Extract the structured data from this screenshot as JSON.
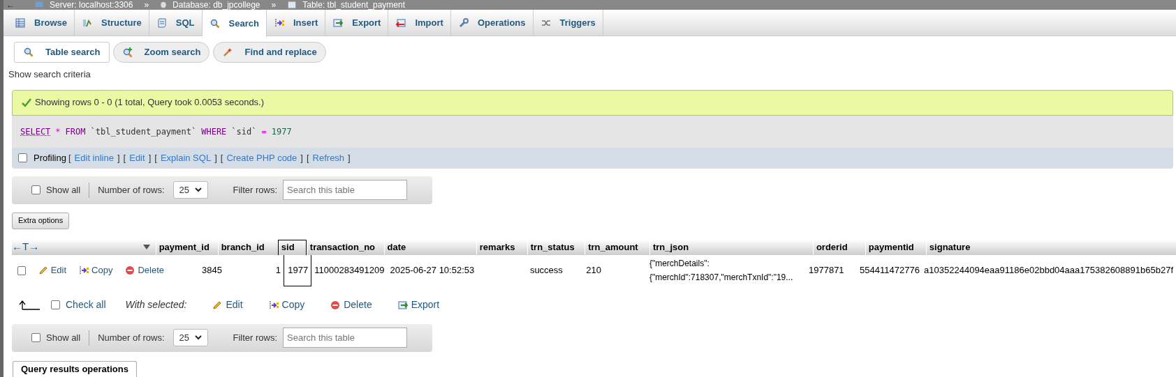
{
  "breadcrumb": [
    {
      "kind": "server",
      "label": "Server: localhost:3306"
    },
    {
      "kind": "database",
      "label": "Database: db_jpcollege"
    },
    {
      "kind": "table",
      "label": "Table: tbl_student_payment"
    }
  ],
  "breadcrumb_separator": "»",
  "back_arrow": "←",
  "tabs": [
    {
      "kind": "browse",
      "label": "Browse",
      "selected": false
    },
    {
      "kind": "structure",
      "label": "Structure",
      "selected": false
    },
    {
      "kind": "sql",
      "label": "SQL",
      "selected": false
    },
    {
      "kind": "search",
      "label": "Search",
      "selected": true
    },
    {
      "kind": "insert",
      "label": "Insert",
      "selected": false
    },
    {
      "kind": "export",
      "label": "Export",
      "selected": false
    },
    {
      "kind": "import",
      "label": "Import",
      "selected": false
    },
    {
      "kind": "operations",
      "label": "Operations",
      "selected": false
    },
    {
      "kind": "triggers",
      "label": "Triggers",
      "selected": false
    }
  ],
  "subtabs": [
    {
      "kind": "search",
      "label": "Table search",
      "selected": true
    },
    {
      "kind": "zoom",
      "label": "Zoom search",
      "selected": false
    },
    {
      "kind": "replace",
      "label": "Find and replace",
      "selected": false
    }
  ],
  "show_search_criteria": "Show search criteria",
  "message": "Showing rows 0 - 0 (1 total, Query took 0.0053 seconds.)",
  "sql": [
    {
      "kind": "keyword",
      "text": "SELECT"
    },
    {
      "kind": "op",
      "text": "*"
    },
    {
      "kind": "keyword",
      "text": "FROM"
    },
    {
      "kind": "ident",
      "text": "`tbl_student_payment`"
    },
    {
      "kind": "keyword",
      "text": "WHERE"
    },
    {
      "kind": "ident",
      "text": "`sid`"
    },
    {
      "kind": "op",
      "text": "="
    },
    {
      "kind": "number",
      "text": "1977"
    }
  ],
  "profiling": {
    "label": "Profiling",
    "checked": false,
    "open_bracket": "[",
    "close_bracket": "]",
    "links": [
      "Edit inline",
      "Edit",
      "Explain SQL",
      "Create PHP code",
      "Refresh"
    ]
  },
  "nav_bars": [
    {
      "show_all": "Show all",
      "show_all_checked": false,
      "rows_label": "Number of rows:",
      "rows_value": "25",
      "filter_label": "Filter rows:",
      "filter_placeholder": "Search this table"
    },
    {
      "show_all": "Show all",
      "show_all_checked": false,
      "rows_label": "Number of rows:",
      "rows_value": "25",
      "filter_label": "Filter rows:",
      "filter_placeholder": "Search this table"
    }
  ],
  "extra_options": "Extra options",
  "table": {
    "arrows": "←T→",
    "columns": [
      {
        "label": "payment_id",
        "kind": "int",
        "marked": false
      },
      {
        "label": "branch_id",
        "kind": "int",
        "marked": false
      },
      {
        "label": "sid",
        "kind": "int",
        "marked": true
      },
      {
        "label": "transaction_no",
        "kind": "text",
        "marked": false
      },
      {
        "label": "date",
        "kind": "text",
        "marked": false
      },
      {
        "label": "remarks",
        "kind": "text",
        "marked": false
      },
      {
        "label": "trn_status",
        "kind": "text",
        "marked": false
      },
      {
        "label": "trn_amount",
        "kind": "text",
        "marked": false
      },
      {
        "label": "trn_json",
        "kind": "json",
        "marked": false
      },
      {
        "label": "orderid",
        "kind": "text",
        "marked": false
      },
      {
        "label": "paymentid",
        "kind": "text",
        "marked": false
      },
      {
        "label": "signature",
        "kind": "text",
        "marked": false
      }
    ],
    "rows": [
      {
        "checked": false,
        "actions": [
          {
            "kind": "edit",
            "label": "Edit"
          },
          {
            "kind": "copy",
            "label": "Copy"
          },
          {
            "kind": "delete",
            "label": "Delete"
          }
        ],
        "cells": [
          "3845",
          "1",
          "1977",
          "11000283491209",
          "2025-06-27 10:52:53",
          "",
          "success",
          "210",
          "{\"merchDetails\": {\"merchId\":718307,\"merchTxnId\":\"19...",
          "1977871",
          "554411472776",
          "a10352244094eaa91186e02bbd04aaa175382608891b65b27f"
        ]
      }
    ]
  },
  "bulk": {
    "check_all": "Check all",
    "checked": false,
    "with_selected": "With selected:",
    "actions": [
      {
        "kind": "edit",
        "label": "Edit"
      },
      {
        "kind": "copy",
        "label": "Copy"
      },
      {
        "kind": "delete",
        "label": "Delete"
      },
      {
        "kind": "export",
        "label": "Export"
      }
    ]
  },
  "query_results_operations": "Query results operations"
}
